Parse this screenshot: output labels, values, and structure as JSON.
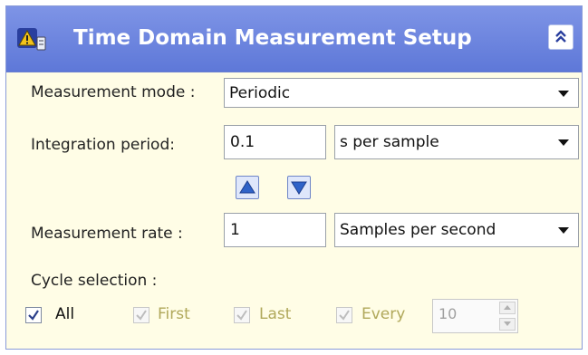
{
  "header": {
    "title": "Time Domain Measurement Setup",
    "app_icon": "measurement-setup-icon",
    "collapse_icon": "double-chevron-up-icon"
  },
  "measurement_mode": {
    "label": "Measurement mode :",
    "value": "Periodic"
  },
  "integration_period": {
    "label": "Integration period:",
    "value": "0.1",
    "unit": "s per sample",
    "increase_icon": "triangle-up-icon",
    "decrease_icon": "triangle-down-icon"
  },
  "measurement_rate": {
    "label": "Measurement rate :",
    "value": "1",
    "unit": "Samples per second"
  },
  "cycle_selection": {
    "label": "Cycle selection :",
    "options": [
      {
        "label": "All",
        "checked": true,
        "enabled": true
      },
      {
        "label": "First",
        "checked": true,
        "enabled": false
      },
      {
        "label": "Last",
        "checked": true,
        "enabled": false
      },
      {
        "label": "Every",
        "checked": true,
        "enabled": false
      }
    ],
    "every_value": "10"
  },
  "colors": {
    "header": "#6a82dc",
    "panel_bg": "#fffde6",
    "disabled_label": "#b0a85a"
  }
}
